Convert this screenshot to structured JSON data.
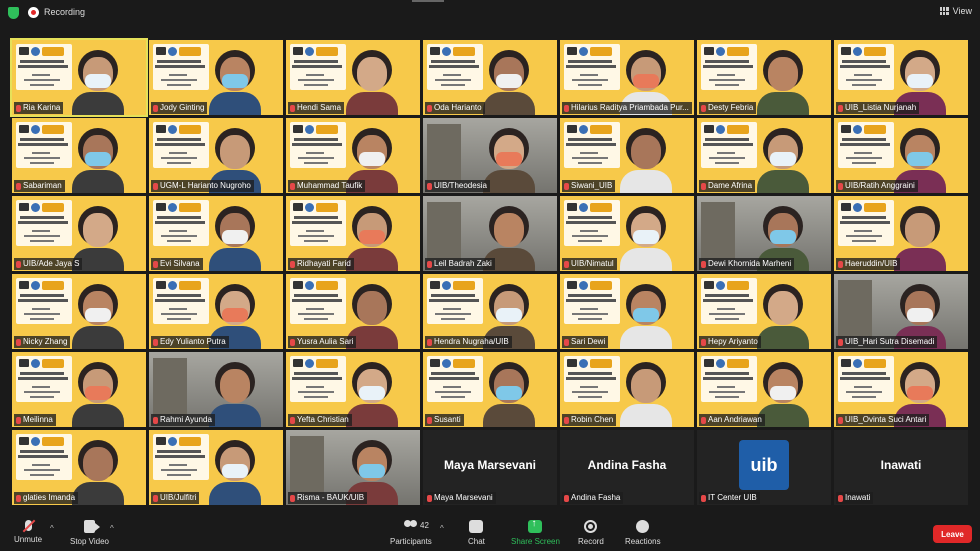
{
  "topbar": {
    "recording_label": "Recording",
    "view_label": "View"
  },
  "banner": {
    "title_line1": "Diskusi Internal",
    "title_line2": "Dokumen SPMI UIB",
    "day": "Jumat,",
    "date": "3 September 2021",
    "brand": "Kampus Merdeka"
  },
  "participants": [
    {
      "name": "Ria Karina",
      "style": "banner",
      "active": true
    },
    {
      "name": "Jody Ginting",
      "style": "banner"
    },
    {
      "name": "Hendi Sama",
      "style": "banner"
    },
    {
      "name": "Oda Harianto",
      "style": "banner"
    },
    {
      "name": "Hilarius Raditya Priambada Pur...",
      "style": "banner"
    },
    {
      "name": "Desty Febria",
      "style": "banner"
    },
    {
      "name": "UIB_Listia Nurjanah",
      "style": "banner"
    },
    {
      "name": "Sabariman",
      "style": "banner"
    },
    {
      "name": "UGM-L Harianto Nugroho",
      "style": "banner"
    },
    {
      "name": "Muhammad Taufik",
      "style": "banner"
    },
    {
      "name": "UIB/Theodesia",
      "style": "room"
    },
    {
      "name": "Siwani_UIB",
      "style": "banner"
    },
    {
      "name": "Dame Afrina",
      "style": "banner"
    },
    {
      "name": "UIB/Ratih Anggraini",
      "style": "banner"
    },
    {
      "name": "UIB/Ade Jaya S",
      "style": "banner"
    },
    {
      "name": "Evi Silvana",
      "style": "banner"
    },
    {
      "name": "Ridhayati Farid",
      "style": "banner"
    },
    {
      "name": "Leil Badrah Zaki",
      "style": "room"
    },
    {
      "name": "UIB/Nimatul",
      "style": "banner"
    },
    {
      "name": "Dewi Khornida Marheni",
      "style": "room"
    },
    {
      "name": "Haeruddin/UIB",
      "style": "banner"
    },
    {
      "name": "Nicky Zhang",
      "style": "banner"
    },
    {
      "name": "Edy Yulianto Putra",
      "style": "banner"
    },
    {
      "name": "Yusra Aulia Sari",
      "style": "banner"
    },
    {
      "name": "Hendra Nugraha/UIB",
      "style": "banner"
    },
    {
      "name": "Sari Dewi",
      "style": "banner"
    },
    {
      "name": "Hepy Ariyanto",
      "style": "banner"
    },
    {
      "name": "UIB_Hari Sutra Disemadi",
      "style": "room"
    },
    {
      "name": "Meilinna",
      "style": "banner"
    },
    {
      "name": "Rahmi Ayunda",
      "style": "room"
    },
    {
      "name": "Yefta Christian",
      "style": "banner"
    },
    {
      "name": "Susanti",
      "style": "banner"
    },
    {
      "name": "Robin Chen",
      "style": "banner"
    },
    {
      "name": "Aan Andriawan",
      "style": "banner"
    },
    {
      "name": "UIB_Ovinta Suci Antari",
      "style": "banner"
    },
    {
      "name": "glaties Imanda",
      "style": "banner"
    },
    {
      "name": "UIB/Julfitri",
      "style": "banner"
    },
    {
      "name": "Risma - BAUK/UIB",
      "style": "room"
    },
    {
      "name": "Maya Marsevani",
      "style": "name-only",
      "big": "Maya Marsevani"
    },
    {
      "name": "Andina Fasha",
      "style": "name-only",
      "big": "Andina Fasha"
    },
    {
      "name": "IT Center UIB",
      "style": "logo",
      "logo_text": "uib"
    },
    {
      "name": "Inawati",
      "style": "name-only",
      "big": "Inawati"
    }
  ],
  "toolbar": {
    "unmute": "Unmute",
    "stop_video": "Stop Video",
    "participants": "Participants",
    "participant_count": "42",
    "chat": "Chat",
    "share_screen": "Share Screen",
    "record": "Record",
    "reactions": "Reactions",
    "leave": "Leave"
  },
  "colors": {
    "banner_yellow": "#f7c94a",
    "share_green": "#2fbf5b",
    "leave_red": "#e02828",
    "active_outline": "#e6e15a"
  }
}
